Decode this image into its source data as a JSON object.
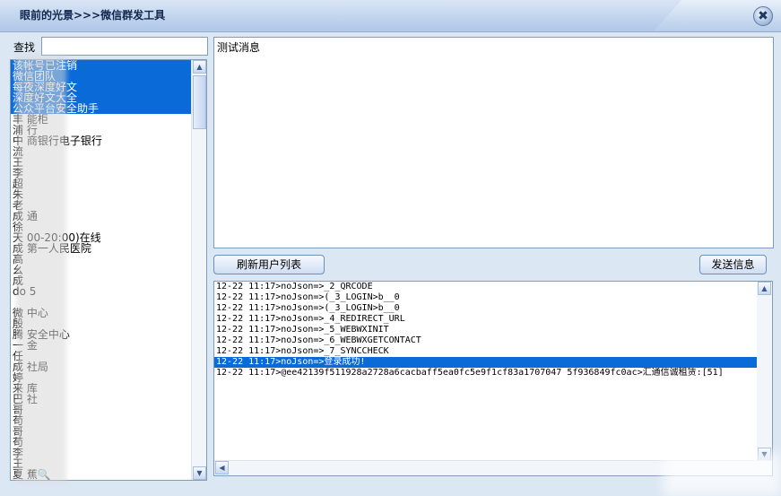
{
  "window": {
    "title": "眼前的光景>>>微信群发工具",
    "close_glyph": "✖"
  },
  "search": {
    "label": "查找",
    "value": "",
    "placeholder": ""
  },
  "user_list": {
    "items": [
      {
        "label": "该帐号已注销",
        "selected": true
      },
      {
        "label": "微信团队",
        "selected": true
      },
      {
        "label": "每夜深度好文",
        "selected": true
      },
      {
        "label": "深度好文大全",
        "selected": true
      },
      {
        "label": "公众平台安全助手",
        "selected": true
      },
      {
        "label": "丰 能柜",
        "selected": false
      },
      {
        "label": "浦 行",
        "selected": false
      },
      {
        "label": "中 商银行电子银行",
        "selected": false
      },
      {
        "label": "流",
        "selected": false
      },
      {
        "label": "王",
        "selected": false
      },
      {
        "label": "李",
        "selected": false
      },
      {
        "label": "超",
        "selected": false
      },
      {
        "label": "朱",
        "selected": false
      },
      {
        "label": "老",
        "selected": false
      },
      {
        "label": "成 通",
        "selected": false
      },
      {
        "label": "徐",
        "selected": false
      },
      {
        "label": "天 00-20:00)在线",
        "selected": false
      },
      {
        "label": "成 第一人民医院",
        "selected": false
      },
      {
        "label": "高",
        "selected": false
      },
      {
        "label": "幺",
        "selected": false
      },
      {
        "label": "成",
        "selected": false
      },
      {
        "label": "do 5",
        "selected": false
      },
      {
        "label": "",
        "selected": false
      },
      {
        "label": "微 中心",
        "selected": false
      },
      {
        "label": "殷",
        "selected": false
      },
      {
        "label": "腾 安全中心",
        "selected": false
      },
      {
        "label": "一 金",
        "selected": false
      },
      {
        "label": "任",
        "selected": false
      },
      {
        "label": "成 社局",
        "selected": false
      },
      {
        "label": "婷",
        "selected": false
      },
      {
        "label": "来 库",
        "selected": false
      },
      {
        "label": "巴 社",
        "selected": false
      },
      {
        "label": "哥",
        "selected": false
      },
      {
        "label": "苟",
        "selected": false
      },
      {
        "label": "哥",
        "selected": false
      },
      {
        "label": "苟",
        "selected": false
      },
      {
        "label": "李",
        "selected": false
      },
      {
        "label": "王",
        "selected": false
      },
      {
        "label": "夏 蕉🔍",
        "selected": false
      }
    ]
  },
  "message": {
    "value": "测试消息"
  },
  "buttons": {
    "refresh_label": "刷新用户列表",
    "send_label": "发送信息"
  },
  "log": {
    "lines": [
      {
        "text": "12-22 11:17>noJson=>_2_QRCODE",
        "selected": false
      },
      {
        "text": "12-22 11:17>noJson=>(_3_LOGIN>b__0",
        "selected": false
      },
      {
        "text": "12-22 11:17>noJson=>(_3_LOGIN>b__0",
        "selected": false
      },
      {
        "text": "12-22 11:17>noJson=>_4_REDIRECT_URL",
        "selected": false
      },
      {
        "text": "12-22 11:17>noJson=>_5_WEBWXINIT",
        "selected": false
      },
      {
        "text": "12-22 11:17>noJson=>_6_WEBWXGETCONTACT",
        "selected": false
      },
      {
        "text": "12-22 11:17>noJson=>_7_SYNCCHECK",
        "selected": false
      },
      {
        "text": "12-22 11:17>noJson=>登录成功!",
        "selected": true
      },
      {
        "text": "12-22 11:17>@ee42139f511928a2728a6cacbaff5ea0fc5e9f1cf83a1707047 5f936849fc0ac>汇通信诚租赁:[51]",
        "selected": false
      }
    ]
  },
  "colors": {
    "selection": "#0a6ad8",
    "background": "#dce7f4",
    "border": "#7f9db9"
  }
}
